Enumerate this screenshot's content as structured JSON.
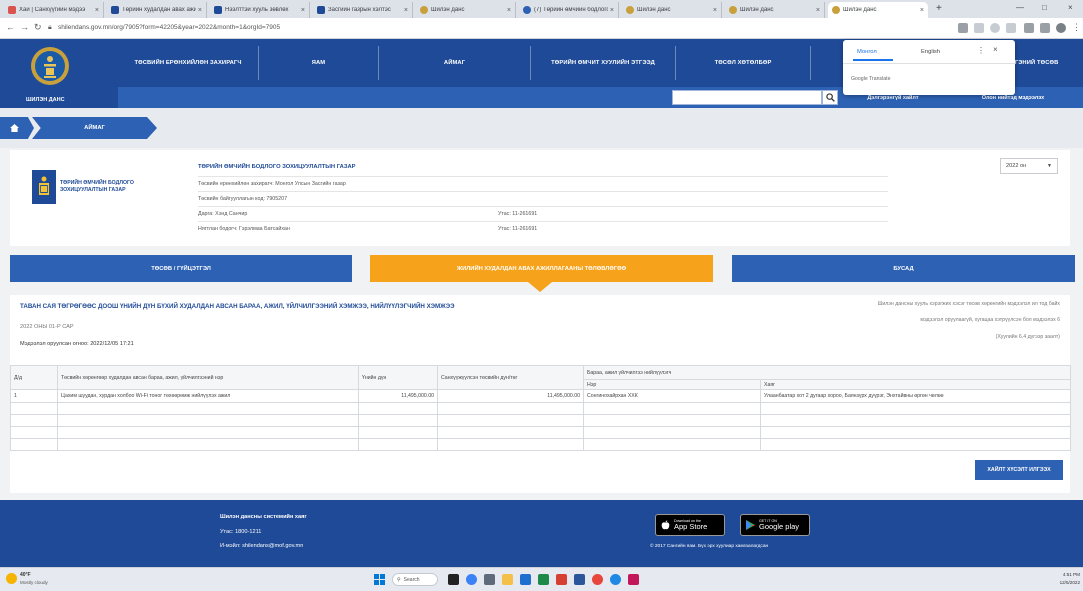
{
  "browser": {
    "tabs": [
      {
        "title": "Хай | Санхүүгийн мэдээ"
      },
      {
        "title": "Төрийн худалдан авах ажиллагаа"
      },
      {
        "title": "Нээлттэй хууль зөвлөх"
      },
      {
        "title": "Засгийн газрын хэлтэс"
      },
      {
        "title": "Шилэн данс"
      },
      {
        "title": "(7) Төрийн өмчийн бодлого"
      },
      {
        "title": "Шилэн данс"
      },
      {
        "title": "Шилэн данс"
      },
      {
        "title": "Шилэн данс"
      }
    ],
    "url": "shilendans.gov.mn/org/7905?form=42205&year=2022&month=1&orgId=7905"
  },
  "header": {
    "logo_label": "ШИЛЭН ДАНС",
    "nav": [
      "ТӨСВИЙН ЕРӨНХИЙЛӨН ЗАХИРАГЧ",
      "ЯАМ",
      "АЙМАГ",
      "ТӨРИЙН ӨМЧИТ ХУУЛИЙН ЭТГЭЭД",
      "ТӨСӨЛ ХӨТӨЛБӨР",
      "ИРГЭНИЙ ТӨСӨВ"
    ],
    "advanced_search": "Дэлгэрэнгүй хайлт",
    "public_info": "Олон нийтэд мэдээлэх"
  },
  "translate_popup": {
    "source_lang": "Монгол",
    "target_lang": "English",
    "label": "Google Translate"
  },
  "breadcrumb": {
    "current": "АЙМАГ"
  },
  "organization": {
    "logo_text": [
      "ТӨРИЙН ӨМЧИЙН БОДЛОГО",
      "ЗОХИЦУУЛАЛТЫН ГАЗАР"
    ],
    "name": "ТӨРИЙН ӨМЧИЙН БОДЛОГО ЗОХИЦУУЛАЛТЫН ГАЗАР",
    "rows": [
      {
        "left": "Төсвийн ерөнхийлөн захирагч: Монгол Улсын Засгийн газар",
        "right": ""
      },
      {
        "left": "Төсвийн байгууллагын код: 7905207",
        "right": ""
      },
      {
        "left": "Дарга: Хэнд Санчир",
        "right": "Утас: 11-261691"
      },
      {
        "left": "Нягтлан бодогч: Гэрэлмаа Батсайхан",
        "right": "Утас: 11-261691"
      }
    ],
    "year": "2022 он"
  },
  "section_tabs": [
    "ТӨСӨВ / ГҮЙЦЭТГЭЛ",
    "ЖИЛИЙН ХУДАЛДАН АВАХ АЖИЛЛАГААНЫ ТӨЛӨВЛӨГӨӨ",
    "БУСАД"
  ],
  "report": {
    "title": "ТАВАН САЯ ТӨГРӨГӨӨС ДООШ ҮНИЙН ДҮН БҮХИЙ ХУДАЛДАН АВСАН БАРАА, АЖИЛ, ҮЙЛЧИЛГЭЭНИЙ ХЭМЖЭЭ, НИЙЛҮҮЛЭГЧИЙН ХЭМЖЭЭ",
    "month": "2022 ОНЫ 01-Р САР",
    "entered": "Мэдээлэл оруулсан огноо: 2022/12/05 17:21",
    "notes": [
      "Шилэн дансны хууль хэрэгжих хэсэг төсөв хөрөнгийн мэдээлэл ил тод байх",
      "мэдээлэл оруулаагүй, хугацаа хэтрүүлсэн бол мэдээлэх 6",
      "(Хуулийн 6.4 дүгээр заалт)"
    ],
    "send_button": "ХАЙЛТ ХҮСЭЛТ ИЛГЭЭХ"
  },
  "table": {
    "headers": [
      "Д/д",
      "Төсвийн хөрөнгөөр худалдан авсан бараа, ажил, үйлчилгээний нэр",
      "Үнийн дүн",
      "Санхүүжүүлсэн төсвийн дүн/төг",
      "Бараа, ажил үйлчилгээ нийлүүлэгч"
    ],
    "subheaders": [
      "Нэр",
      "Хаяг"
    ],
    "rows": [
      [
        "1",
        "Цахим шуудан, хурдан холбоо Wi-Fi тоног төхөөрөмж нийлүүлэх ажил",
        "11,495,000.00",
        "11,495,000.00",
        "Сонгинохайрхан ХХК",
        "Улаанбаатар хот 2 дугаар хороо, Баянзүрх дүүрэг, Энхтайвны өргөн чөлөө"
      ]
    ]
  },
  "footer": {
    "heading": "Шилэн дансны системийн хаяг",
    "phone": "Утас: 1800-1211",
    "email": "И-мэйл: shilendans@mof.gov.mn",
    "appstore_small": "Download on the",
    "appstore": "App Store",
    "googleplay_small": "GET IT ON",
    "googleplay": "Google play",
    "copyright": "© 2017 Сангийн яам. Бүх эрх хуулиар хамгаалагдсан"
  },
  "taskbar": {
    "weather_temp": "40°F",
    "weather_desc": "Mostly cloudy",
    "search": "Search",
    "time": "4:51 PM",
    "date": "12/5/2022"
  },
  "colors": {
    "header_blue": "#1e4a97",
    "band_blue": "#2d61b3",
    "active_tab_orange": "#f6a21b"
  }
}
